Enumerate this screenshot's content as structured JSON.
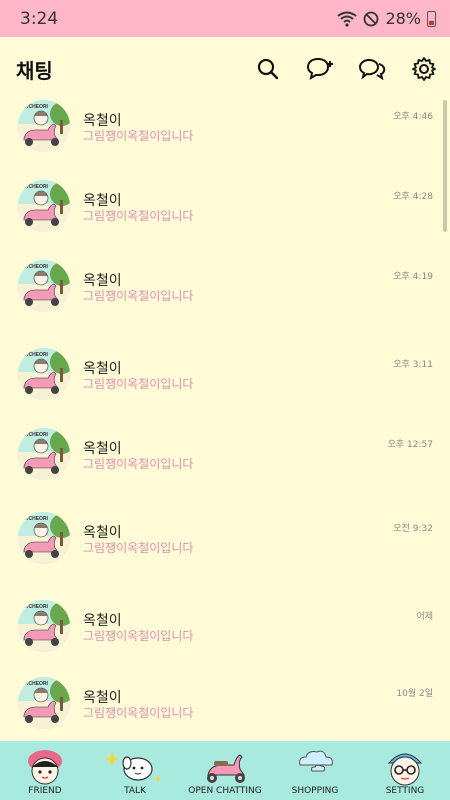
{
  "status": {
    "time": "3:24",
    "battery": "28%"
  },
  "header": {
    "title": "채팅"
  },
  "chats": [
    {
      "name": "옥철이",
      "preview": "그림쟁이옥철이입니다",
      "time": "오후 4:46"
    },
    {
      "name": "옥철이",
      "preview": "그림쟁이옥철이입니다",
      "time": "오후 4:28"
    },
    {
      "name": "옥철이",
      "preview": "그림쟁이옥철이입니다",
      "time": "오후 4:19"
    },
    {
      "name": "옥철이",
      "preview": "그림쟁이옥철이입니다",
      "time": "오후 3:11"
    },
    {
      "name": "옥철이",
      "preview": "그림쟁이옥철이입니다",
      "time": "오후 12:57"
    },
    {
      "name": "옥철이",
      "preview": "그림쟁이옥철이입니다",
      "time": "오전 9:32"
    },
    {
      "name": "옥철이",
      "preview": "그림쟁이옥철이입니다",
      "time": "어제"
    },
    {
      "name": "옥철이",
      "preview": "그림쟁이옥철이입니다",
      "time": "10월 2일"
    }
  ],
  "avatar_text": "OKCHEORI",
  "nav": {
    "friend": "FRIEND",
    "talk": "TALK",
    "open_chatting": "OPEN CHATTING",
    "shopping": "SHOPPING",
    "setting": "SETTING"
  },
  "colors": {
    "status_bar": "#ffb6c8",
    "background": "#fffbd6",
    "nav_bg": "#a9eadf",
    "preview_text": "#e08fb0"
  }
}
